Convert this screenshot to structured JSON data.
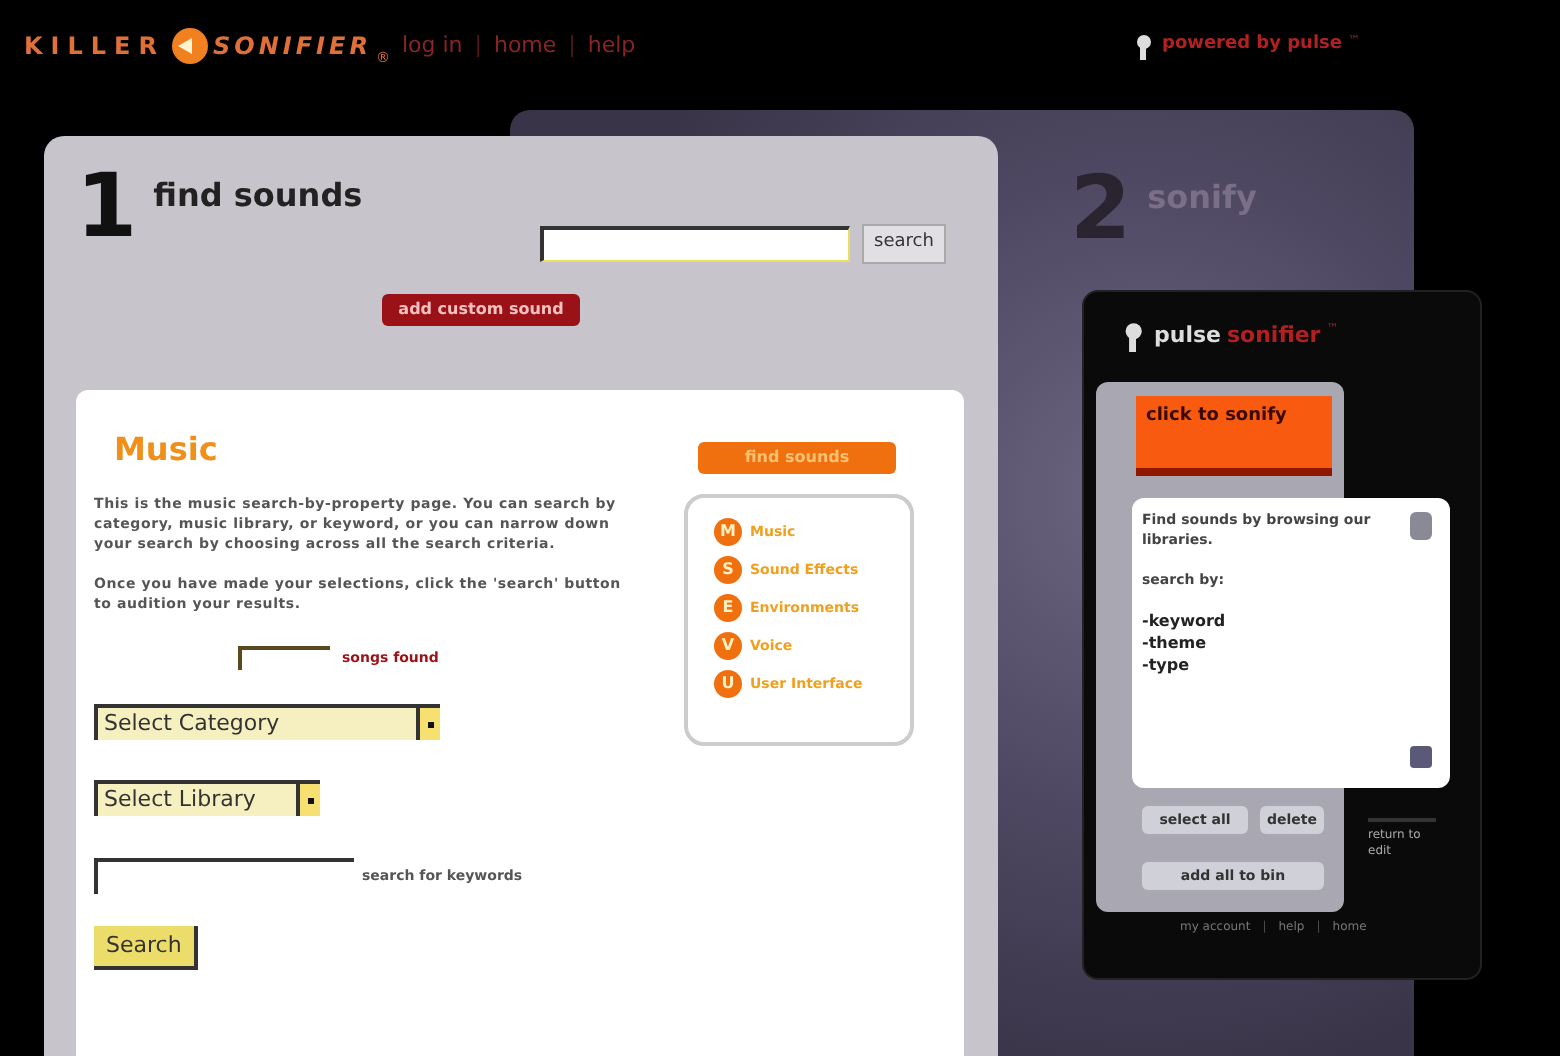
{
  "header": {
    "logo_left": "KILLER",
    "logo_right": "SONIFIER",
    "logo_mark": "®",
    "nav": [
      {
        "kind": "link",
        "text": "log in"
      },
      {
        "kind": "separator",
        "text": "|"
      },
      {
        "kind": "link",
        "text": "home"
      },
      {
        "kind": "separator",
        "text": "|"
      },
      {
        "kind": "link",
        "text": "help"
      }
    ],
    "powered_by": "powered by pulse",
    "powered_mark": "™"
  },
  "step1": {
    "number": "1",
    "title": "find sounds",
    "search_button": "search",
    "custom_button": "add custom sound"
  },
  "card": {
    "title": "Music",
    "find_button": "find sounds",
    "paragraphs": [
      "This is the music search-by-property page. You can search by category, music library, or keyword, or you can narrow down your search by choosing across all the search criteria.",
      "Once you have made your selections, click the 'search' button to audition your results."
    ],
    "categories": [
      {
        "badge": "M",
        "label": "Music"
      },
      {
        "badge": "S",
        "label": "Sound Effects"
      },
      {
        "badge": "E",
        "label": "Environments"
      },
      {
        "badge": "V",
        "label": "Voice"
      },
      {
        "badge": "U",
        "label": "User Interface"
      }
    ],
    "songs_found": "songs found",
    "category_select": "Select Category",
    "library_select": "Select Library",
    "keyword_label": "search for keywords",
    "search_button": "Search"
  },
  "step2": {
    "number": "2",
    "title": "sonify"
  },
  "sonifier": {
    "brand": "pulse",
    "brand_accent": "sonifier",
    "brand_mark": "™",
    "sonify_button": "click to sonify",
    "text_lines": [
      {
        "kind": "plain",
        "text": "Find sounds by browsing our libraries."
      },
      {
        "kind": "plain",
        "text": "search by:"
      },
      {
        "kind": "bold",
        "text": "-keyword"
      },
      {
        "kind": "bold",
        "text": "-theme"
      },
      {
        "kind": "bold",
        "text": "-type"
      }
    ],
    "select_all": "select all",
    "delete": "delete",
    "add_all": "add all to bin",
    "return": "return to edit",
    "footer": [
      {
        "kind": "link",
        "text": "my account"
      },
      {
        "kind": "separator",
        "text": "|"
      },
      {
        "kind": "link",
        "text": "help"
      },
      {
        "kind": "separator",
        "text": "|"
      },
      {
        "kind": "link",
        "text": "home"
      }
    ]
  }
}
